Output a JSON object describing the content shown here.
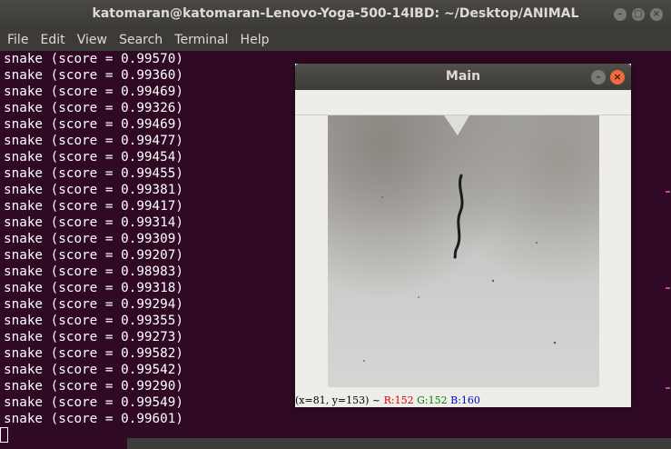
{
  "window": {
    "title": "katomaran@katomaran-Lenovo-Yoga-500-14IBD: ~/Desktop/ANIMAL",
    "buttons": {
      "minimize": "–",
      "maximize": "□",
      "close": "×"
    }
  },
  "menu": [
    "File",
    "Edit",
    "View",
    "Search",
    "Terminal",
    "Help"
  ],
  "terminal": {
    "lines": [
      "snake (score = 0.99570)",
      "snake (score = 0.99360)",
      "snake (score = 0.99469)",
      "snake (score = 0.99326)",
      "snake (score = 0.99469)",
      "snake (score = 0.99477)",
      "snake (score = 0.99454)",
      "snake (score = 0.99455)",
      "snake (score = 0.99381)",
      "snake (score = 0.99417)",
      "snake (score = 0.99314)",
      "snake (score = 0.99309)",
      "snake (score = 0.99207)",
      "snake (score = 0.98983)",
      "snake (score = 0.99318)",
      "snake (score = 0.99294)",
      "snake (score = 0.99355)",
      "snake (score = 0.99273)",
      "snake (score = 0.99582)",
      "snake (score = 0.99542)",
      "snake (score = 0.99290)",
      "snake (score = 0.99549)",
      "snake (score = 0.99601)"
    ]
  },
  "main_window": {
    "title": "Main",
    "buttons": {
      "minimize": "–",
      "close": "×"
    },
    "status": {
      "coords": "(x=81, y=153) ~",
      "r": "R:152",
      "g": "G:152",
      "b": "B:160"
    }
  },
  "colors": {
    "terminal_bg": "#300a24",
    "titlebar": "#3c3b37",
    "close_button": "#f06a3c",
    "status_r": "#d00000",
    "status_g": "#008000",
    "status_b": "#0000cc"
  }
}
